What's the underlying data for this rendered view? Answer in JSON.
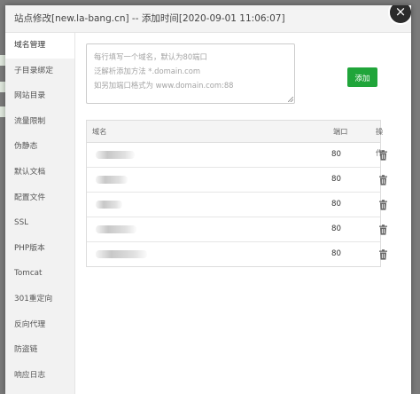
{
  "window": {
    "title": "站点修改[new.la-bang.cn] -- 添加时间[2020-09-01 11:06:07]",
    "close_icon": "close-icon"
  },
  "sidebar": {
    "items": [
      {
        "label": "域名管理",
        "active": true
      },
      {
        "label": "子目录绑定"
      },
      {
        "label": "网站目录"
      },
      {
        "label": "流量限制"
      },
      {
        "label": "伪静态"
      },
      {
        "label": "默认文档"
      },
      {
        "label": "配置文件"
      },
      {
        "label": "SSL"
      },
      {
        "label": "PHP版本"
      },
      {
        "label": "Tomcat"
      },
      {
        "label": "301重定向"
      },
      {
        "label": "反向代理"
      },
      {
        "label": "防盗链"
      },
      {
        "label": "响应日志"
      }
    ]
  },
  "domain_input": {
    "placeholder_lines": [
      "每行填写一个域名，默认为80端口",
      "泛解析添加方法 *.domain.com",
      "如另加端口格式为 www.domain.com:88"
    ]
  },
  "add_button": {
    "label": "添加",
    "color": "#20a53a"
  },
  "table": {
    "headers": {
      "domain": "域名",
      "port": "端口",
      "op": "操作"
    },
    "rows": [
      {
        "port": "80",
        "action_icon": "trash-icon"
      },
      {
        "port": "80",
        "action_icon": "trash-icon"
      },
      {
        "port": "80",
        "action_icon": "trash-icon"
      },
      {
        "port": "80",
        "action_icon": "trash-icon"
      },
      {
        "port": "80",
        "action_icon": "trash-icon"
      }
    ]
  }
}
